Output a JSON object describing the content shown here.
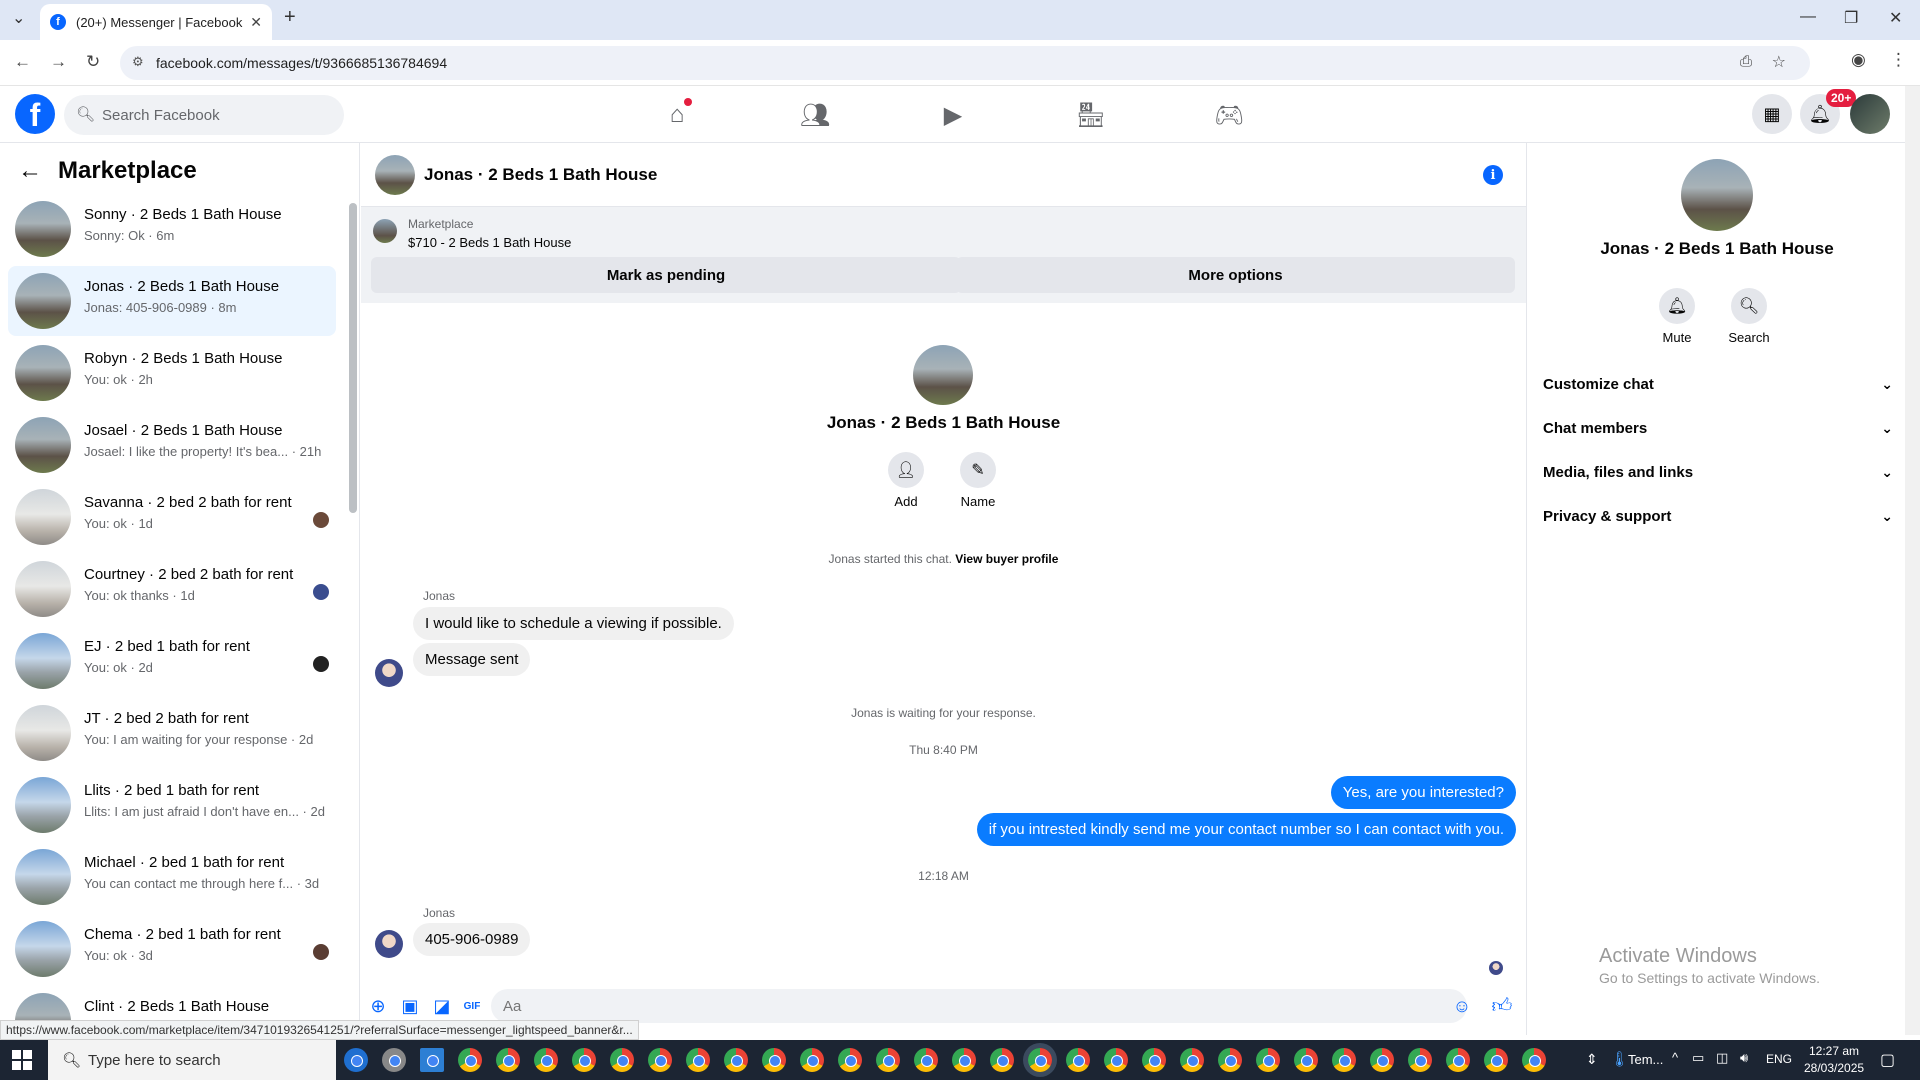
{
  "browser": {
    "tab_title": "(20+) Messenger | Facebook",
    "url": "facebook.com/messages/t/9366685136784694",
    "status_url": "https://www.facebook.com/marketplace/item/3471019326541251/?referralSurface=messenger_lightspeed_banner&r..."
  },
  "header": {
    "search_placeholder": "Search Facebook",
    "notification_count": "20+"
  },
  "left_panel": {
    "title": "Marketplace",
    "conversations": [
      {
        "name": "Sonny · 2 Beds 1 Bath House",
        "preview": "Sonny: Ok · 6m"
      },
      {
        "name": "Jonas · 2 Beds 1 Bath House",
        "preview": "Jonas: 405-906-0989 · 8m"
      },
      {
        "name": "Robyn · 2 Beds 1 Bath House",
        "preview": "You: ok · 2h"
      },
      {
        "name": "Josael · 2 Beds 1 Bath House",
        "preview": "Josael: I like the property! It's bea... · 21h"
      },
      {
        "name": "Savanna · 2 bed 2 bath for rent",
        "preview": "You: ok · 1d"
      },
      {
        "name": "Courtney · 2 bed 2 bath for rent",
        "preview": "You: ok thanks · 1d"
      },
      {
        "name": "EJ · 2 bed 1 bath for rent",
        "preview": "You: ok · 2d"
      },
      {
        "name": "JT · 2 bed 2 bath for rent",
        "preview": "You: I am waiting for your response · 2d"
      },
      {
        "name": "Llits · 2 bed 1 bath for rent",
        "preview": "Llits: I am just afraid I don't have en... · 2d"
      },
      {
        "name": "Michael · 2 bed 1 bath for rent",
        "preview": "You can contact me through here f... · 3d"
      },
      {
        "name": "Chema · 2 bed 1 bath for rent",
        "preview": "You: ok · 3d"
      },
      {
        "name": "Clint · 2 Beds 1 Bath House",
        "preview": ""
      }
    ]
  },
  "chat": {
    "title": "Jonas · 2 Beds 1 Bath House",
    "banner_label": "Marketplace",
    "banner_item": "$710 - 2 Beds 1 Bath House",
    "mark_pending": "Mark as pending",
    "more_options": "More options",
    "intro_name": "Jonas · 2 Beds 1 Bath House",
    "add_label": "Add",
    "name_label": "Name",
    "started_text": "Jonas started this chat.",
    "view_profile": "View buyer profile",
    "sender1": "Jonas",
    "msg1": "I would like to schedule a viewing if possible.",
    "msg2": "Message sent",
    "waiting": "Jonas is waiting for your response.",
    "time1": "Thu 8:40 PM",
    "out1": "Yes, are you interested?",
    "out2": "if you intrested kindly send me your contact number so I can contact with you.",
    "time2": "12:18 AM",
    "sender2": "Jonas",
    "msg3": "405-906-0989",
    "input_placeholder": "Aa"
  },
  "right_panel": {
    "name": "Jonas · 2 Beds 1 Bath House",
    "mute": "Mute",
    "search": "Search",
    "sections": [
      "Customize chat",
      "Chat members",
      "Media, files and links",
      "Privacy & support"
    ],
    "watermark_title": "Activate Windows",
    "watermark_sub": "Go to Settings to activate Windows."
  },
  "taskbar": {
    "search_placeholder": "Type here to search",
    "weather": "Tem...",
    "lang": "ENG",
    "time": "12:27 am",
    "date": "28/03/2025"
  }
}
